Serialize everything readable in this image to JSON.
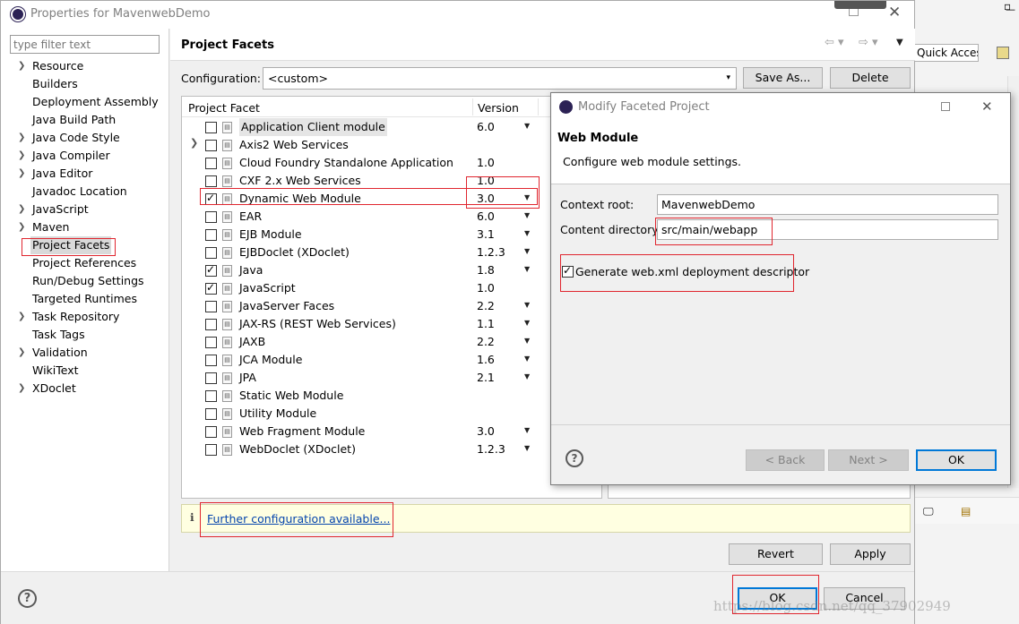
{
  "window": {
    "title": "Properties for MavenwebDemo"
  },
  "behind": {
    "quick_access": "Quick Access"
  },
  "filter": {
    "placeholder": "type filter text"
  },
  "tree": [
    {
      "label": "Resource",
      "expandable": true
    },
    {
      "label": "Builders",
      "expandable": false
    },
    {
      "label": "Deployment Assembly",
      "expandable": false
    },
    {
      "label": "Java Build Path",
      "expandable": false
    },
    {
      "label": "Java Code Style",
      "expandable": true
    },
    {
      "label": "Java Compiler",
      "expandable": true
    },
    {
      "label": "Java Editor",
      "expandable": true
    },
    {
      "label": "Javadoc Location",
      "expandable": false
    },
    {
      "label": "JavaScript",
      "expandable": true
    },
    {
      "label": "Maven",
      "expandable": true
    },
    {
      "label": "Project Facets",
      "expandable": false,
      "selected": true
    },
    {
      "label": "Project References",
      "expandable": false
    },
    {
      "label": "Run/Debug Settings",
      "expandable": false
    },
    {
      "label": "Targeted Runtimes",
      "expandable": false
    },
    {
      "label": "Task Repository",
      "expandable": true
    },
    {
      "label": "Task Tags",
      "expandable": false
    },
    {
      "label": "Validation",
      "expandable": true
    },
    {
      "label": "WikiText",
      "expandable": false
    },
    {
      "label": "XDoclet",
      "expandable": true
    }
  ],
  "page": {
    "title": "Project Facets",
    "configuration_label": "Configuration:",
    "configuration_value": "<custom>",
    "save_as": "Save As...",
    "delete": "Delete",
    "col_facet": "Project Facet",
    "col_version": "Version",
    "info_link": "Further configuration available...",
    "revert": "Revert",
    "apply": "Apply",
    "ok": "OK",
    "cancel": "Cancel"
  },
  "facets": [
    {
      "name": "Application Client module",
      "version": "6.0",
      "dropdown": true,
      "checked": false
    },
    {
      "name": "Axis2 Web Services",
      "version": "",
      "dropdown": false,
      "checked": false,
      "expandable": true
    },
    {
      "name": "Cloud Foundry Standalone Application",
      "version": "1.0",
      "dropdown": false,
      "checked": false
    },
    {
      "name": "CXF 2.x Web Services",
      "version": "1.0",
      "dropdown": false,
      "checked": false
    },
    {
      "name": "Dynamic Web Module",
      "version": "3.0",
      "dropdown": true,
      "checked": true
    },
    {
      "name": "EAR",
      "version": "6.0",
      "dropdown": true,
      "checked": false
    },
    {
      "name": "EJB Module",
      "version": "3.1",
      "dropdown": true,
      "checked": false
    },
    {
      "name": "EJBDoclet (XDoclet)",
      "version": "1.2.3",
      "dropdown": true,
      "checked": false
    },
    {
      "name": "Java",
      "version": "1.8",
      "dropdown": true,
      "checked": true
    },
    {
      "name": "JavaScript",
      "version": "1.0",
      "dropdown": false,
      "checked": true
    },
    {
      "name": "JavaServer Faces",
      "version": "2.2",
      "dropdown": true,
      "checked": false
    },
    {
      "name": "JAX-RS (REST Web Services)",
      "version": "1.1",
      "dropdown": true,
      "checked": false
    },
    {
      "name": "JAXB",
      "version": "2.2",
      "dropdown": true,
      "checked": false
    },
    {
      "name": "JCA Module",
      "version": "1.6",
      "dropdown": true,
      "checked": false
    },
    {
      "name": "JPA",
      "version": "2.1",
      "dropdown": true,
      "checked": false
    },
    {
      "name": "Static Web Module",
      "version": "",
      "dropdown": false,
      "checked": false
    },
    {
      "name": "Utility Module",
      "version": "",
      "dropdown": false,
      "checked": false
    },
    {
      "name": "Web Fragment Module",
      "version": "3.0",
      "dropdown": true,
      "checked": false
    },
    {
      "name": "WebDoclet (XDoclet)",
      "version": "1.2.3",
      "dropdown": true,
      "checked": false
    }
  ],
  "modal": {
    "title": "Modify Faceted Project",
    "heading": "Web Module",
    "description": "Configure web module settings.",
    "context_root_label": "Context root:",
    "context_root_value": "MavenwebDemo",
    "content_dir_label": "Content directory:",
    "content_dir_value": "src/main/webapp",
    "generate_label": "Generate web.xml deployment descriptor",
    "generate_checked": true,
    "back": "< Back",
    "next": "Next >",
    "ok": "OK"
  },
  "watermark": "https://blog.csdn.net/qq_37902949"
}
